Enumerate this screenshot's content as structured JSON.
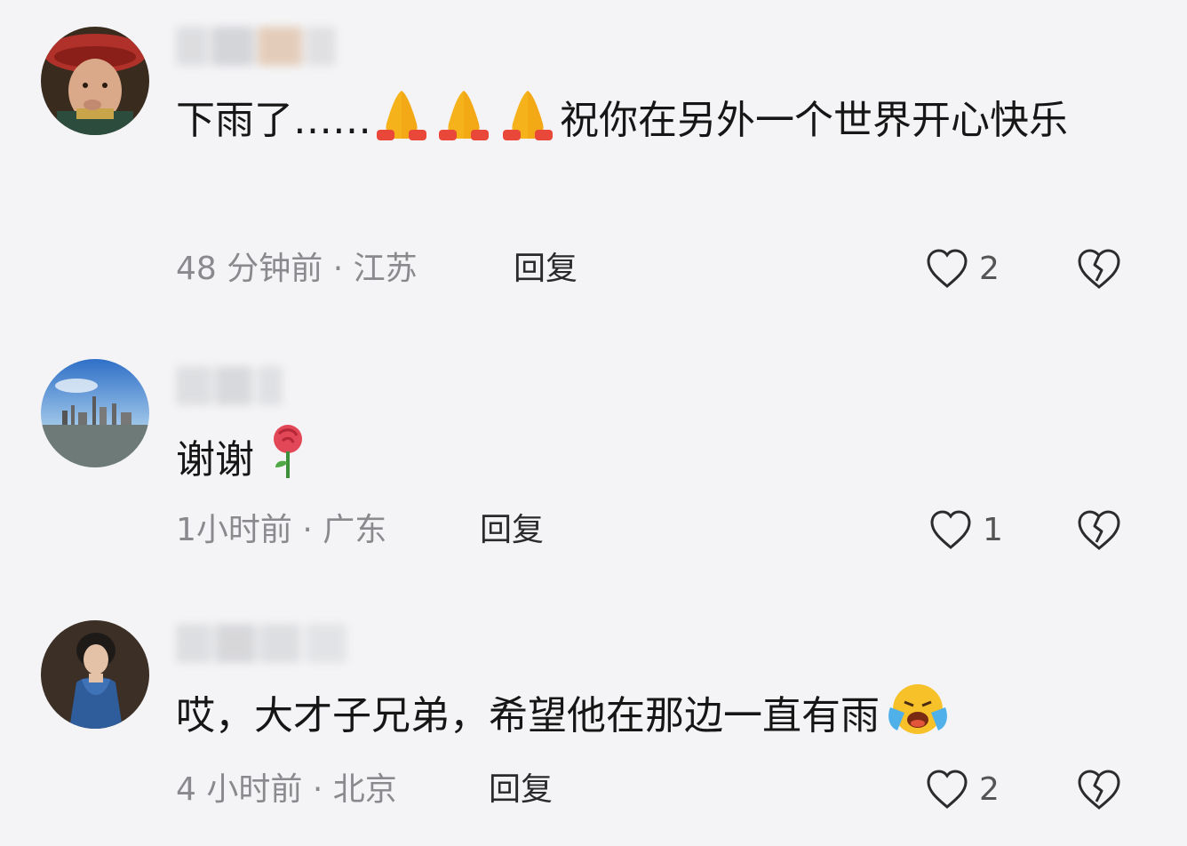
{
  "comments": [
    {
      "text": "下雨了……",
      "text_after": "祝你在另外一个世界开心快乐",
      "emoji": [
        "folded-hands",
        "folded-hands",
        "folded-hands"
      ],
      "time": "48 分钟前",
      "location": "江苏",
      "reply_label": "回复",
      "likes": "2"
    },
    {
      "text": "谢谢",
      "emoji": [
        "rose"
      ],
      "time": "1小时前",
      "location": "广东",
      "reply_label": "回复",
      "likes": "1"
    },
    {
      "text": "哎，大才子兄弟，希望他在那边一直有雨",
      "emoji": [
        "crying-face"
      ],
      "time": "4 小时前",
      "location": "北京",
      "reply_label": "回复",
      "likes": "2"
    }
  ],
  "separator": "·",
  "colors": {
    "background": "#f4f4f6",
    "meta_text": "#8a8a8e",
    "icon_stroke": "#2b2b2b"
  },
  "icons": [
    "heart-outline-icon",
    "broken-heart-icon"
  ]
}
